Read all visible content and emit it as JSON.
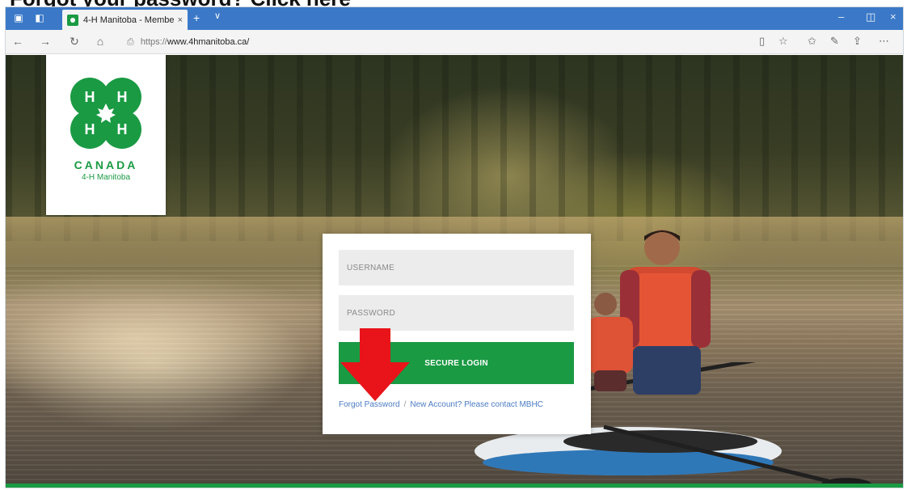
{
  "page_heading": "Forgot your password? Click here",
  "browser": {
    "tab_title": "4-H Manitoba - Membe",
    "tab_close": "×",
    "new_tab": "+",
    "tab_menu": "∨",
    "window_controls": {
      "minimize": "–",
      "restore": "◫",
      "close": "×"
    },
    "nav": {
      "back": "←",
      "forward": "→",
      "refresh": "↻",
      "home": "⌂"
    },
    "url_prefix": "https://",
    "url_host": "www.4hmanitoba.ca/",
    "right_icons": [
      "reading-view-icon",
      "star-icon",
      "favorites-icon",
      "pen-icon",
      "share-icon",
      "more-icon"
    ]
  },
  "logo": {
    "brand": "CANADA",
    "sub": "4-H Manitoba",
    "clover_color": "#1a9a43"
  },
  "login": {
    "username_placeholder": "USERNAME",
    "password_placeholder": "PASSWORD",
    "submit_label": "SECURE LOGIN",
    "forgot_link": "Forgot Password",
    "separator": "/",
    "new_account_link": "New Account? Please contact MBHC"
  },
  "colors": {
    "brand_green": "#1a9a43",
    "browser_blue": "#3b79c8",
    "arrow_red": "#e8141a",
    "link_blue": "#4b7cc4"
  }
}
